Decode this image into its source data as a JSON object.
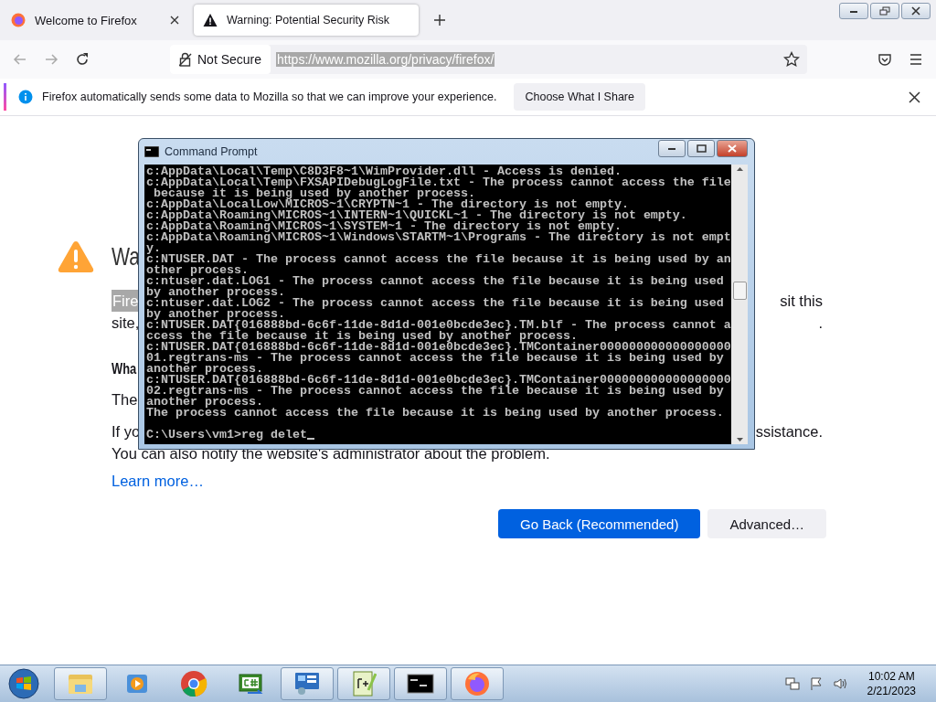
{
  "browser": {
    "tabs": [
      {
        "title": "Welcome to Firefox",
        "selected": false
      },
      {
        "title": "Warning: Potential Security Risk",
        "selected": true
      }
    ],
    "nav": {
      "security_label": "Not Secure",
      "url": "https://www.mozilla.org/privacy/firefox/",
      "url_selected": true
    },
    "notification": {
      "message": "Firefox automatically sends some data to Mozilla so that we can improve your experience.",
      "button": "Choose What I Share"
    },
    "page": {
      "rows": [
        {
          "kind": "heading",
          "left": "Wa",
          "selected": false
        },
        {
          "kind": "text",
          "left": "Fire",
          "right": "sit this",
          "selected": true
        },
        {
          "kind": "text",
          "left": "site,",
          "right": ".",
          "selected": false
        },
        {
          "kind": "subheading",
          "left": "Wha",
          "selected": false
        },
        {
          "kind": "text",
          "left": "The",
          "selected": false
        },
        {
          "kind": "text",
          "left": "If yo",
          "right": "ssistance.",
          "selected": false
        },
        {
          "kind": "text",
          "left": "You can also notify the website's administrator about the problem.",
          "selected": false
        },
        {
          "kind": "link",
          "left": "Learn more…",
          "selected": false
        }
      ],
      "buttons": [
        {
          "label": "Go Back (Recommended)",
          "primary": true
        },
        {
          "label": "Advanced…",
          "primary": false
        }
      ]
    }
  },
  "command_prompt": {
    "title": "Command Prompt",
    "output_lines": [
      "c:AppData\\Local\\Temp\\C8D3F8~1\\WimProvider.dll - Access is denied.",
      "c:AppData\\Local\\Temp\\FXSAPIDebugLogFile.txt - The process cannot access the file",
      " because it is being used by another process.",
      "c:AppData\\LocalLow\\MICROS~1\\CRYPTN~1 - The directory is not empty.",
      "c:AppData\\Roaming\\MICROS~1\\INTERN~1\\QUICKL~1 - The directory is not empty.",
      "c:AppData\\Roaming\\MICROS~1\\SYSTEM~1 - The directory is not empty.",
      "c:AppData\\Roaming\\MICROS~1\\Windows\\STARTM~1\\Programs - The directory is not empt",
      "y.",
      "c:NTUSER.DAT - The process cannot access the file because it is being used by an",
      "other process.",
      "c:ntuser.dat.LOG1 - The process cannot access the file because it is being used",
      "by another process.",
      "c:ntuser.dat.LOG2 - The process cannot access the file because it is being used",
      "by another process.",
      "c:NTUSER.DAT{016888bd-6c6f-11de-8d1d-001e0bcde3ec}.TM.blf - The process cannot a",
      "ccess the file because it is being used by another process.",
      "c:NTUSER.DAT{016888bd-6c6f-11de-8d1d-001e0bcde3ec}.TMContainer000000000000000000",
      "01.regtrans-ms - The process cannot access the file because it is being used by",
      "another process.",
      "c:NTUSER.DAT{016888bd-6c6f-11de-8d1d-001e0bcde3ec}.TMContainer000000000000000000",
      "02.regtrans-ms - The process cannot access the file because it is being used by",
      "another process.",
      "The process cannot access the file because it is being used by another process."
    ],
    "prompt": "C:\\Users\\vm1>reg delet"
  },
  "taskbar": {
    "apps": [
      {
        "kind": "explorer",
        "running": true
      },
      {
        "kind": "media",
        "running": false
      },
      {
        "kind": "chrome",
        "running": false
      },
      {
        "kind": "csharp",
        "running": false
      },
      {
        "kind": "control",
        "running": true
      },
      {
        "kind": "notepad",
        "running": true
      },
      {
        "kind": "cmd",
        "running": true
      },
      {
        "kind": "firefox",
        "running": true
      }
    ],
    "time": "10:02 AM",
    "date": "2/21/2023"
  }
}
